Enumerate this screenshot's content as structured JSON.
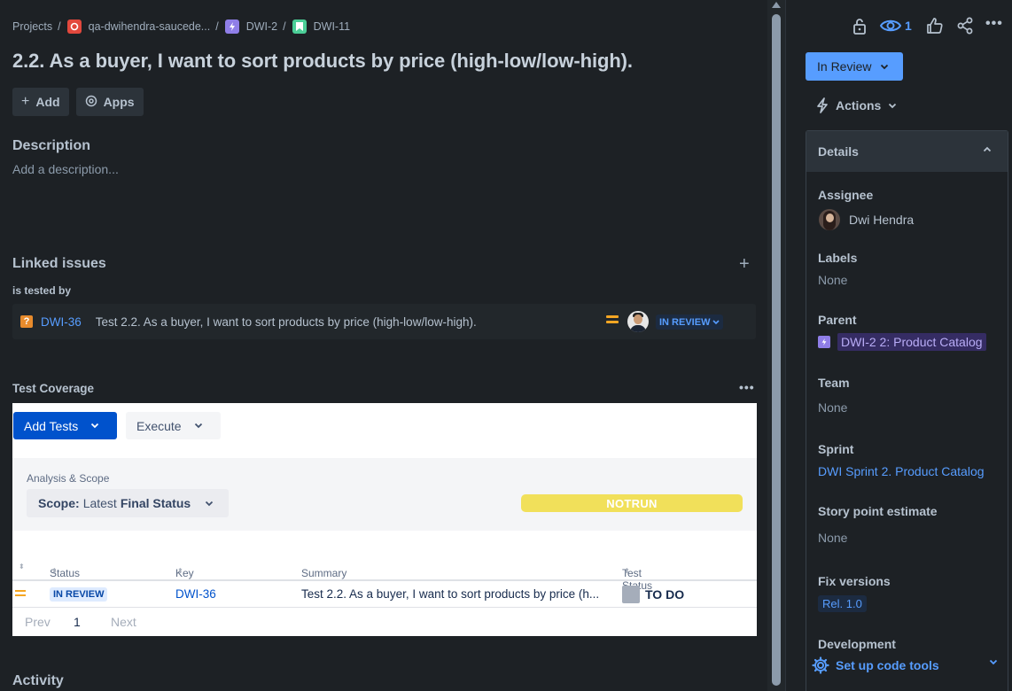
{
  "breadcrumb": {
    "projects": "Projects",
    "separator": "/",
    "project": "qa-dwihendra-saucede...",
    "epic": "DWI-2",
    "issue": "DWI-11"
  },
  "issue": {
    "title": "2.2. As a buyer, I want to sort products by price (high-low/low-high)."
  },
  "toolbar": {
    "add_label": "Add",
    "apps_label": "Apps"
  },
  "description": {
    "heading": "Description",
    "placeholder": "Add a description..."
  },
  "linked_issues": {
    "heading": "Linked issues",
    "relation": "is tested by",
    "items": [
      {
        "icon": "question-icon",
        "key": "DWI-36",
        "summary": "Test 2.2. As a buyer, I want to sort products by price (high-low/low-high).",
        "priority": "medium",
        "status": "IN REVIEW"
      }
    ]
  },
  "test_coverage": {
    "heading": "Test Coverage",
    "add_tests_label": "Add Tests",
    "execute_label": "Execute",
    "scope_label": "Analysis & Scope",
    "scope_prefix": "Scope:",
    "scope_value": "Latest",
    "scope_bold": "Final Status",
    "overall_status": "NOTRUN",
    "columns": [
      "Status",
      "Key",
      "Summary",
      "Test Status"
    ],
    "rows": [
      {
        "priority": "medium",
        "status": "IN REVIEW",
        "key": "DWI-36",
        "summary": "Test 2.2. As a buyer, I want to sort products by price (h...",
        "test_status": "TO DO"
      }
    ],
    "pager": {
      "prev": "Prev",
      "page": "1",
      "next": "Next"
    }
  },
  "activity_heading": "Activity",
  "sidebar": {
    "watch_count": "1",
    "status_button": "In Review",
    "actions_label": "Actions",
    "details_heading": "Details",
    "fields": {
      "assignee_label": "Assignee",
      "assignee_value": "Dwi Hendra",
      "labels_label": "Labels",
      "labels_value": "None",
      "parent_label": "Parent",
      "parent_value": "DWI-2 2: Product Catalog",
      "team_label": "Team",
      "team_value": "None",
      "sprint_label": "Sprint",
      "sprint_value": "DWI Sprint 2. Product Catalog",
      "story_points_label": "Story point estimate",
      "story_points_value": "None",
      "fix_versions_label": "Fix versions",
      "fix_versions_value": "Rel. 1.0",
      "development_label": "Development",
      "development_value": "Set up code tools"
    }
  },
  "colors": {
    "background": "#1d2125",
    "accent": "#579dff",
    "primary_button": "#0052cc",
    "priority_medium": "#f5a623",
    "notrun": "#f1e05a"
  }
}
